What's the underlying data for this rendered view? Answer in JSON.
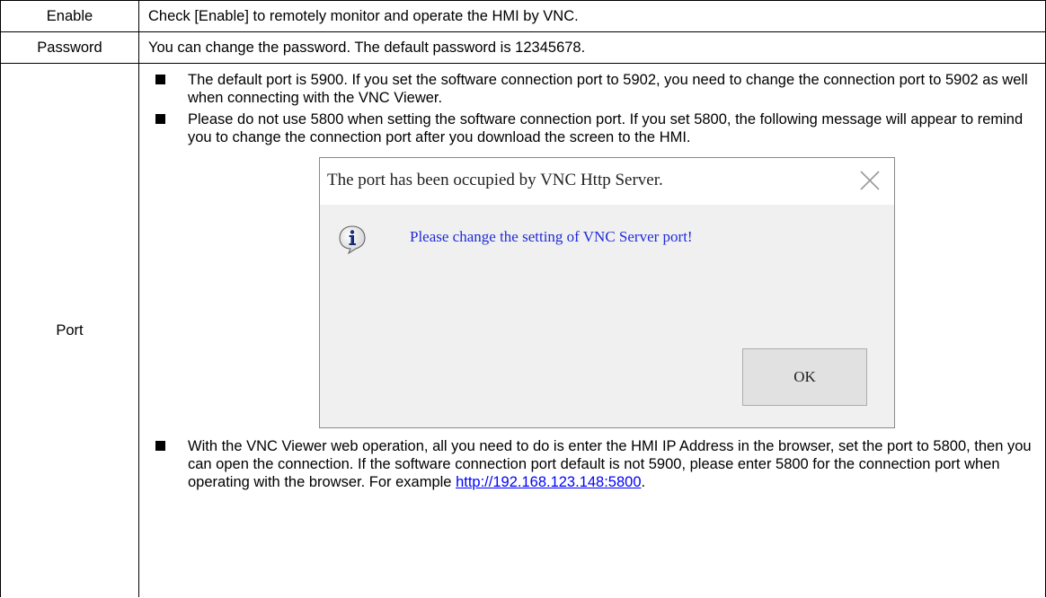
{
  "rows": {
    "enable": {
      "label": "Enable",
      "description": "Check [Enable] to remotely monitor and operate the HMI by VNC."
    },
    "password": {
      "label": "Password",
      "description": "You can change the password. The default password is 12345678."
    },
    "port": {
      "label": "Port",
      "bullets": [
        "The default port is 5900. If you set the software connection port to 5902, you need to change the connection port to 5902 as well when connecting with the VNC Viewer.",
        "Please do not use 5800 when setting the software connection port. If you set 5800, the following message will appear to remind you to change the connection port after you download the screen to the HMI."
      ],
      "last_bullet_text": "With the VNC Viewer web operation, all you need to do is enter the HMI IP Address in the browser, set the port to 5800, then you can open the connection. If the software connection port default is not 5900, please enter 5800 for the connection port when operating with the browser. For example ",
      "last_bullet_link": "http://192.168.123.148:5800",
      "last_bullet_end": "."
    }
  },
  "dialog": {
    "title": "The port has been occupied by VNC Http Server.",
    "message": "Please change the setting of VNC Server port!",
    "ok_label": "OK",
    "icon": "info-icon",
    "close_icon": "close-icon"
  },
  "colors": {
    "link": "#0000ff",
    "dialog_message": "#1f2bd6",
    "dialog_background": "#f0f0f0",
    "button_background": "#e1e1e1"
  }
}
